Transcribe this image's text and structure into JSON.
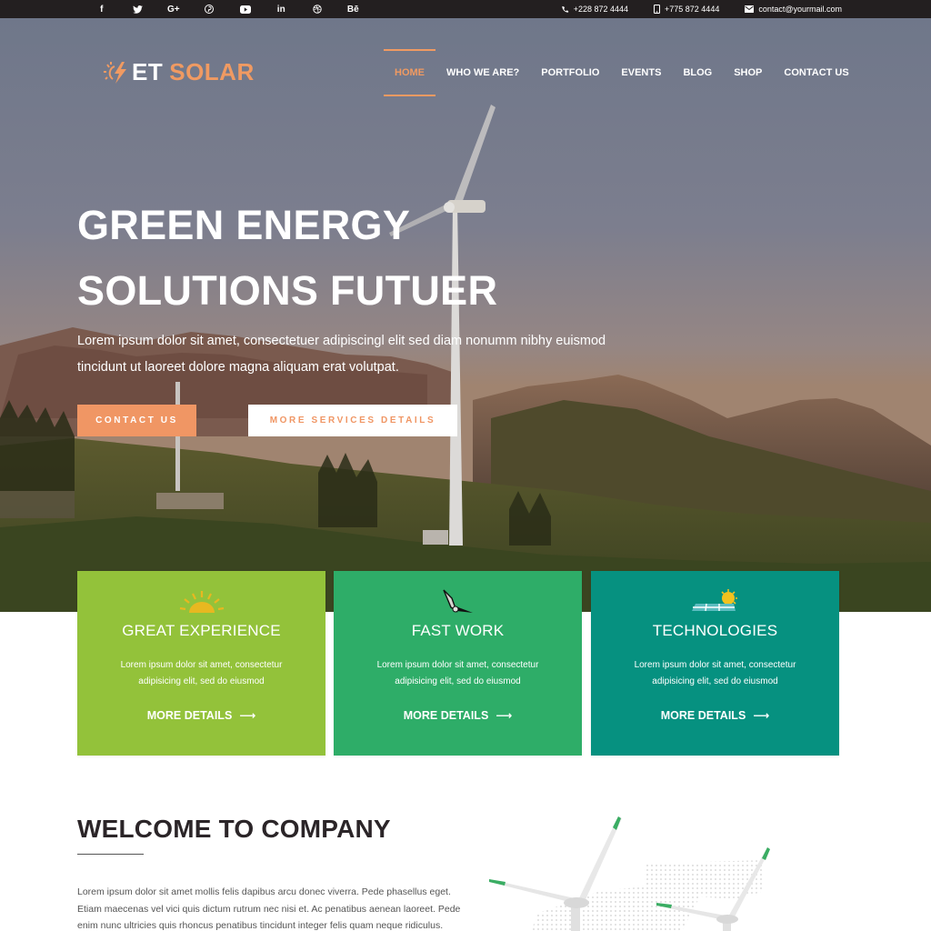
{
  "topbar": {
    "social": [
      {
        "icon": "facebook-icon",
        "glyph": "f"
      },
      {
        "icon": "twitter-icon",
        "glyph": "t"
      },
      {
        "icon": "google-plus-icon",
        "glyph": "G+"
      },
      {
        "icon": "pinterest-icon",
        "glyph": "P"
      },
      {
        "icon": "youtube-icon",
        "glyph": "▶"
      },
      {
        "icon": "linkedin-icon",
        "glyph": "in"
      },
      {
        "icon": "dribbble-icon",
        "glyph": "◎"
      },
      {
        "icon": "behance-icon",
        "glyph": "Bē"
      }
    ],
    "phone": "+228 872 4444",
    "mobile": "+775 872 4444",
    "email": "contact@yourmail.com"
  },
  "logo": {
    "part1": "ET",
    "part2": "SOLAR"
  },
  "nav": {
    "items": [
      {
        "label": "HOME",
        "active": true
      },
      {
        "label": "WHO WE ARE?",
        "active": false
      },
      {
        "label": "PORTFOLIO",
        "active": false
      },
      {
        "label": "EVENTS",
        "active": false
      },
      {
        "label": "BLOG",
        "active": false
      },
      {
        "label": "SHOP",
        "active": false
      },
      {
        "label": "CONTACT US",
        "active": false
      }
    ]
  },
  "hero": {
    "title_line1": "GREEN ENERGY",
    "title_line2": "SOLUTIONS FUTUER",
    "text_line1": "Lorem ipsum dolor sit amet, consectetuer adipiscingl elit sed diam nonumm nibhy euismod",
    "text_line2": "tincidunt ut laoreet dolore magna aliquam erat volutpat.",
    "btn_contact": "CONTACT US",
    "btn_more": "MORE SERVICES DETAILS"
  },
  "cards": [
    {
      "title": "GREAT EXPERIENCE",
      "desc1": "Lorem ipsum dolor sit amet, consectetur",
      "desc2": "adipisicing elit, sed do eiusmod",
      "more": "MORE DETAILS",
      "icon": "sun-icon",
      "color": "#93c23a"
    },
    {
      "title": "FAST WORK",
      "desc1": "Lorem ipsum dolor sit amet, consectetur",
      "desc2": "adipisicing elit, sed do eiusmod",
      "more": "MORE DETAILS",
      "icon": "wind-turbine-icon",
      "color": "#2ead68"
    },
    {
      "title": "TECHNOLOGIES",
      "desc1": "Lorem ipsum dolor sit amet, consectetur",
      "desc2": "adipisicing elit, sed do eiusmod",
      "more": "MORE DETAILS",
      "icon": "solar-panel-icon",
      "color": "#069180"
    }
  ],
  "welcome": {
    "title": "WELCOME TO COMPANY",
    "text": "Lorem ipsum dolor sit amet mollis felis dapibus arcu donec viverra. Pede phasellus eget. Etiam maecenas vel vici quis dictum rutrum nec nisi et. Ac penatibus aenean laoreet. Pede enim nunc ultricies quis rhoncus penatibus tincidunt integer felis quam neque ridiculus."
  },
  "colors": {
    "accent": "#f09a62",
    "topbar": "#231f20",
    "heading": "#2b2528"
  }
}
